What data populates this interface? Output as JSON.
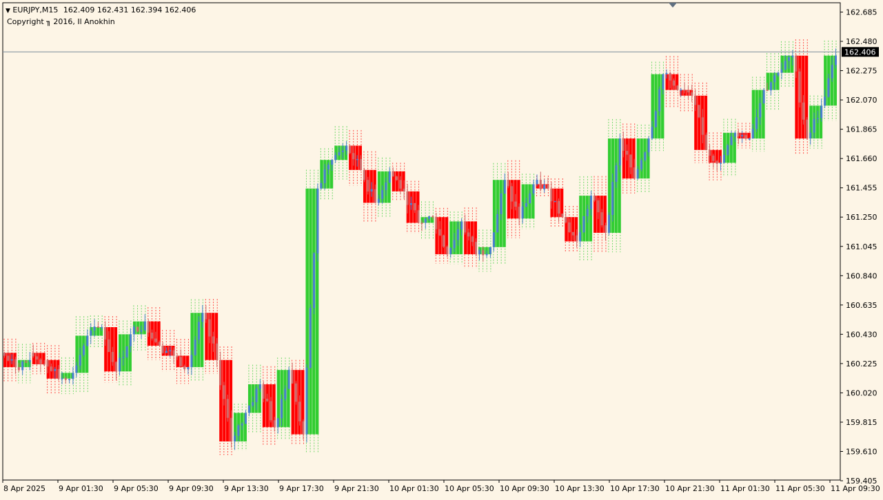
{
  "header": {
    "symbol": "EURJPY,M15",
    "ohlc": "162.409 162.431 162.394 162.406",
    "copyright": "Copyright ╖ 2016, Il Anokhin"
  },
  "colors": {
    "background": "#fdf5e6",
    "bull_block": "#32cd32",
    "bear_block": "#ff0000",
    "candle_up": "#4a7fd0",
    "candle_down": "#d06a6a",
    "price_line": "#7a8a9a",
    "price_tag_bg": "#000000"
  },
  "chart_data": {
    "type": "candlestick",
    "symbol": "EURJPY",
    "timeframe": "M15",
    "ylim": [
      159.41,
      162.75
    ],
    "y_ticks": [
      "162.685",
      "162.480",
      "162.275",
      "162.070",
      "161.865",
      "161.660",
      "161.455",
      "161.250",
      "161.045",
      "160.840",
      "160.635",
      "160.430",
      "160.225",
      "160.020",
      "159.815",
      "159.610",
      "159.405"
    ],
    "x_ticks": [
      "8 Apr 2025",
      "9 Apr 01:30",
      "9 Apr 05:30",
      "9 Apr 09:30",
      "9 Apr 13:30",
      "9 Apr 17:30",
      "9 Apr 21:30",
      "10 Apr 01:30",
      "10 Apr 05:30",
      "10 Apr 09:30",
      "10 Apr 13:30",
      "10 Apr 17:30",
      "10 Apr 21:30",
      "11 Apr 01:30",
      "11 Apr 05:30",
      "11 Apr 09:30"
    ],
    "current_price": "162.406",
    "blocks": [
      {
        "dir": "bear",
        "open": 160.3,
        "close": 160.2
      },
      {
        "dir": "bull",
        "open": 160.2,
        "close": 160.25
      },
      {
        "dir": "bear",
        "open": 160.3,
        "close": 160.22
      },
      {
        "dir": "bear",
        "open": 160.25,
        "close": 160.12
      },
      {
        "dir": "bull",
        "open": 160.12,
        "close": 160.16
      },
      {
        "dir": "bull",
        "open": 160.16,
        "close": 160.42
      },
      {
        "dir": "bull",
        "open": 160.42,
        "close": 160.48
      },
      {
        "dir": "bear",
        "open": 160.48,
        "close": 160.17
      },
      {
        "dir": "bull",
        "open": 160.17,
        "close": 160.43
      },
      {
        "dir": "bull",
        "open": 160.43,
        "close": 160.52
      },
      {
        "dir": "bear",
        "open": 160.52,
        "close": 160.35
      },
      {
        "dir": "bear",
        "open": 160.35,
        "close": 160.28
      },
      {
        "dir": "bear",
        "open": 160.28,
        "close": 160.2
      },
      {
        "dir": "bull",
        "open": 160.2,
        "close": 160.58
      },
      {
        "dir": "bear",
        "open": 160.58,
        "close": 160.25
      },
      {
        "dir": "bear",
        "open": 160.25,
        "close": 159.68
      },
      {
        "dir": "bull",
        "open": 159.68,
        "close": 159.88
      },
      {
        "dir": "bull",
        "open": 159.88,
        "close": 160.08
      },
      {
        "dir": "bear",
        "open": 160.08,
        "close": 159.78
      },
      {
        "dir": "bull",
        "open": 159.78,
        "close": 160.18
      },
      {
        "dir": "bear",
        "open": 160.18,
        "close": 159.73
      },
      {
        "dir": "bull",
        "open": 159.73,
        "close": 161.45
      },
      {
        "dir": "bull",
        "open": 161.45,
        "close": 161.65
      },
      {
        "dir": "bull",
        "open": 161.65,
        "close": 161.75
      },
      {
        "dir": "bear",
        "open": 161.75,
        "close": 161.58
      },
      {
        "dir": "bear",
        "open": 161.58,
        "close": 161.35
      },
      {
        "dir": "bull",
        "open": 161.35,
        "close": 161.57
      },
      {
        "dir": "bear",
        "open": 161.57,
        "close": 161.43
      },
      {
        "dir": "bear",
        "open": 161.43,
        "close": 161.21
      },
      {
        "dir": "bull",
        "open": 161.21,
        "close": 161.25
      },
      {
        "dir": "bear",
        "open": 161.25,
        "close": 160.99
      },
      {
        "dir": "bull",
        "open": 160.99,
        "close": 161.22
      },
      {
        "dir": "bear",
        "open": 161.22,
        "close": 160.99
      },
      {
        "dir": "bull",
        "open": 160.99,
        "close": 161.04
      },
      {
        "dir": "bull",
        "open": 161.04,
        "close": 161.51
      },
      {
        "dir": "bear",
        "open": 161.51,
        "close": 161.24
      },
      {
        "dir": "bull",
        "open": 161.24,
        "close": 161.48
      },
      {
        "dir": "bear",
        "open": 161.48,
        "close": 161.45
      },
      {
        "dir": "bear",
        "open": 161.45,
        "close": 161.25
      },
      {
        "dir": "bear",
        "open": 161.25,
        "close": 161.08
      },
      {
        "dir": "bull",
        "open": 161.08,
        "close": 161.4
      },
      {
        "dir": "bear",
        "open": 161.4,
        "close": 161.14
      },
      {
        "dir": "bull",
        "open": 161.14,
        "close": 161.8
      },
      {
        "dir": "bear",
        "open": 161.8,
        "close": 161.52
      },
      {
        "dir": "bull",
        "open": 161.52,
        "close": 161.8
      },
      {
        "dir": "bull",
        "open": 161.8,
        "close": 162.25
      },
      {
        "dir": "bear",
        "open": 162.25,
        "close": 162.14
      },
      {
        "dir": "bear",
        "open": 162.14,
        "close": 162.1
      },
      {
        "dir": "bear",
        "open": 162.1,
        "close": 161.72
      },
      {
        "dir": "bear",
        "open": 161.72,
        "close": 161.63
      },
      {
        "dir": "bull",
        "open": 161.63,
        "close": 161.84
      },
      {
        "dir": "bear",
        "open": 161.84,
        "close": 161.8
      },
      {
        "dir": "bull",
        "open": 161.8,
        "close": 162.14
      },
      {
        "dir": "bull",
        "open": 162.14,
        "close": 162.26
      },
      {
        "dir": "bull",
        "open": 162.26,
        "close": 162.38
      },
      {
        "dir": "bear",
        "open": 162.38,
        "close": 161.8
      },
      {
        "dir": "bull",
        "open": 161.8,
        "close": 162.03
      },
      {
        "dir": "bull",
        "open": 162.03,
        "close": 162.38
      }
    ]
  }
}
